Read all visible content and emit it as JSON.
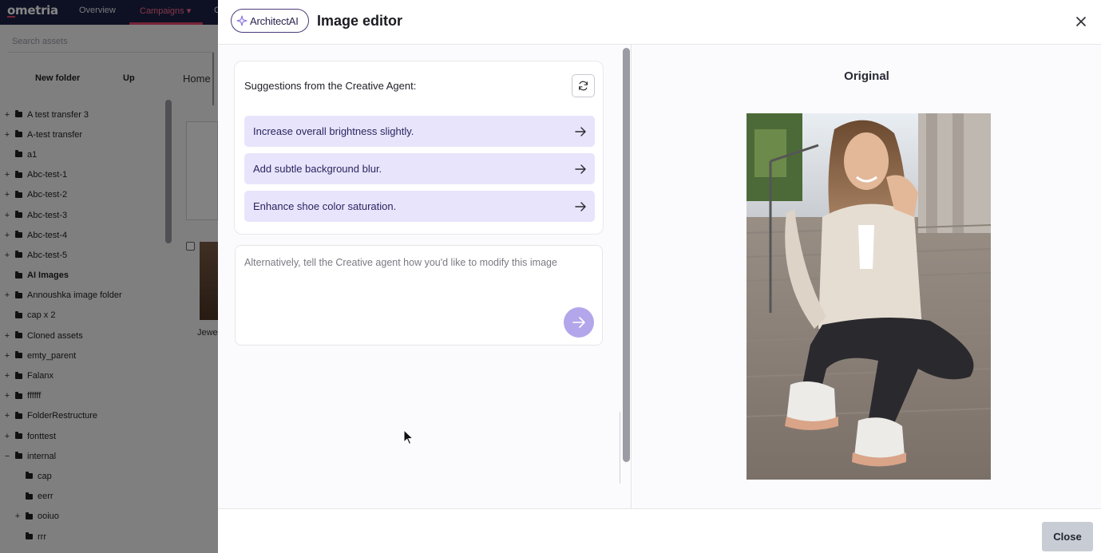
{
  "app": {
    "logo": "ometria",
    "nav": [
      "Overview",
      "Campaigns ▾",
      "C"
    ],
    "search_placeholder": "Search assets",
    "toolbar": {
      "new_folder": "New folder",
      "up": "Up",
      "home": "Home"
    },
    "folders": [
      {
        "label": "A test transfer 3",
        "expand": "+"
      },
      {
        "label": "A-test transfer",
        "expand": "+"
      },
      {
        "label": "a1",
        "expand": ""
      },
      {
        "label": "Abc-test-1",
        "expand": "+"
      },
      {
        "label": "Abc-test-2",
        "expand": "+"
      },
      {
        "label": "Abc-test-3",
        "expand": "+"
      },
      {
        "label": "Abc-test-4",
        "expand": "+"
      },
      {
        "label": "Abc-test-5",
        "expand": "+"
      },
      {
        "label": "AI Images",
        "expand": ""
      },
      {
        "label": "Annoushka image folder",
        "expand": "+"
      },
      {
        "label": "cap x 2",
        "expand": ""
      },
      {
        "label": "Cloned assets",
        "expand": "+"
      },
      {
        "label": "emty_parent",
        "expand": "+"
      },
      {
        "label": "Falanx",
        "expand": "+"
      },
      {
        "label": "ffffff",
        "expand": "+"
      },
      {
        "label": "FolderRestructure",
        "expand": "+"
      },
      {
        "label": "fonttest",
        "expand": "+"
      },
      {
        "label": "internal",
        "expand": "−"
      },
      {
        "label": "cap",
        "expand": ""
      },
      {
        "label": "eerr",
        "expand": ""
      },
      {
        "label": "ooiuo",
        "expand": "+"
      },
      {
        "label": "rrr",
        "expand": ""
      }
    ],
    "thumb_caption": "Jewe"
  },
  "modal": {
    "brand": "ArchitectAI",
    "title": "Image editor",
    "suggestions_title": "Suggestions from the Creative Agent:",
    "suggestions": [
      "Increase overall brightness slightly.",
      "Add subtle background blur.",
      "Enhance shoe color saturation."
    ],
    "prompt_placeholder": "Alternatively, tell the Creative agent how you'd like to modify this image",
    "original_label": "Original",
    "close_button": "Close"
  },
  "colors": {
    "accent": "#b3a6ea",
    "suggestion_bg": "#e8e4fb",
    "nav_bg": "#1c2245",
    "brand_red": "#e2446b"
  }
}
